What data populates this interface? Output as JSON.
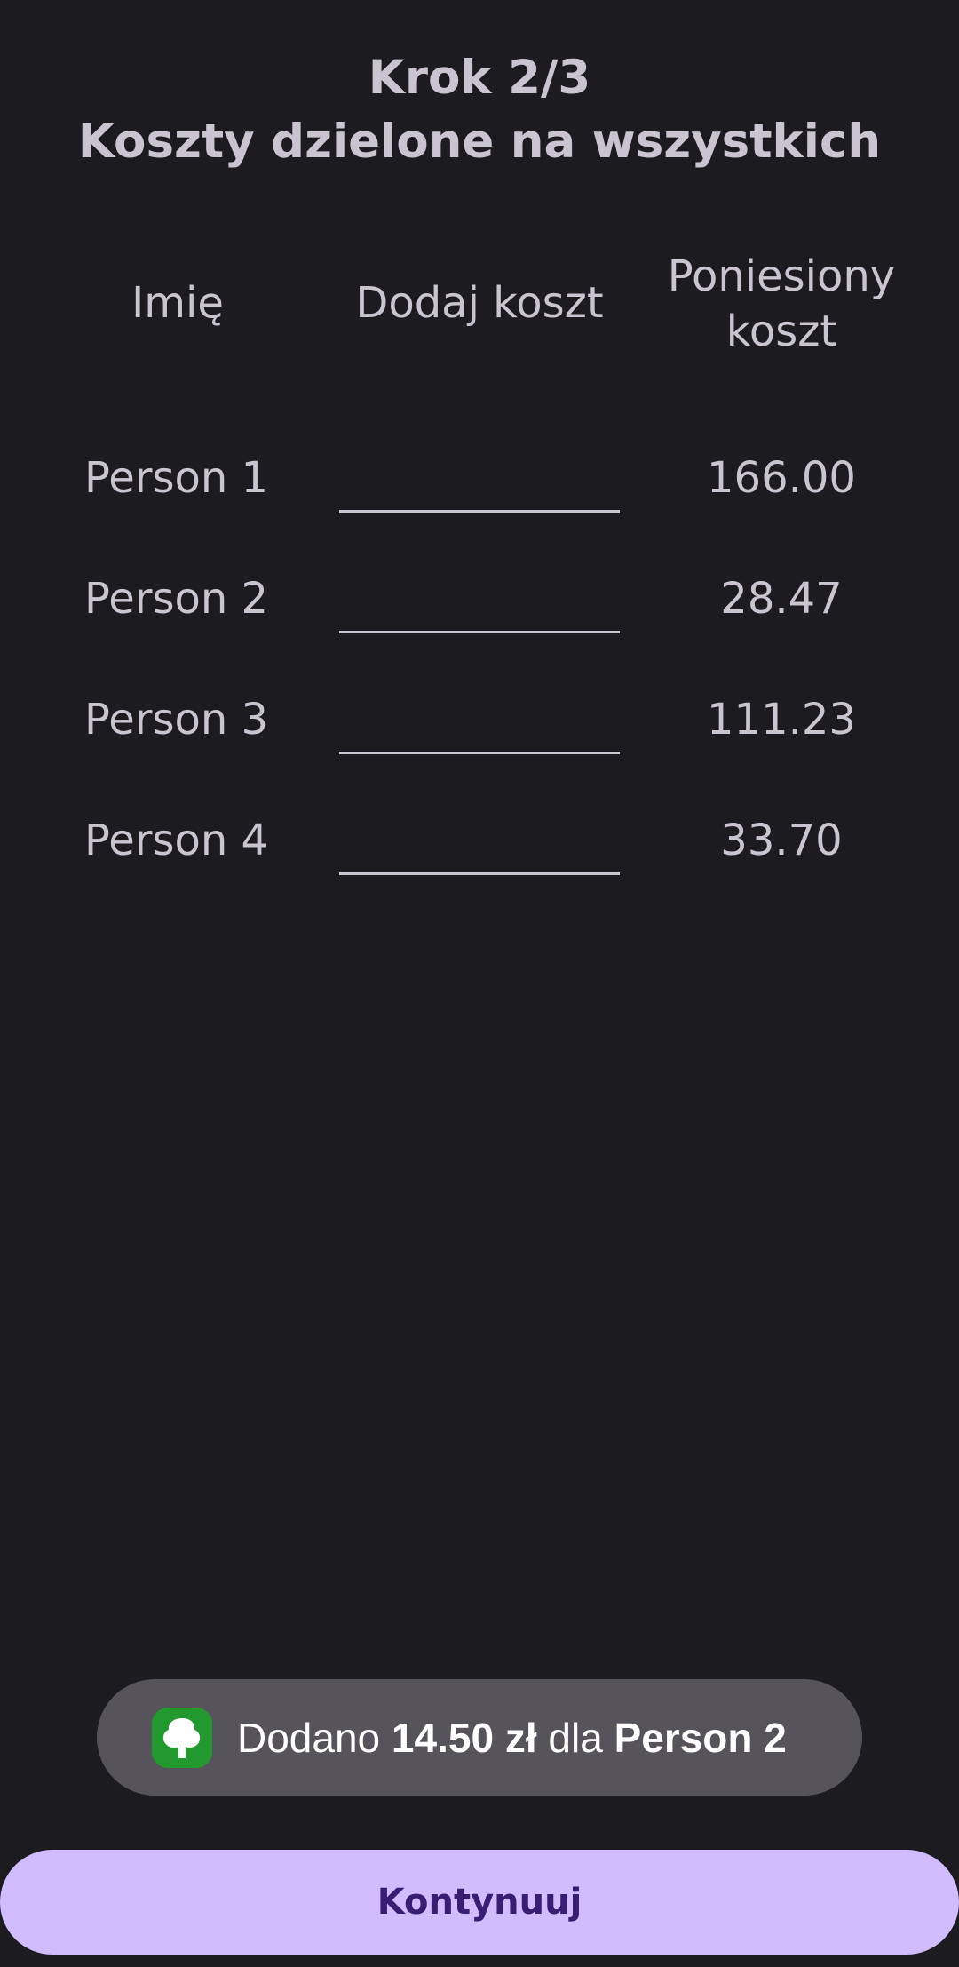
{
  "header": {
    "step": "Krok 2/3",
    "subtitle": "Koszty dzielone na wszystkich"
  },
  "table": {
    "columns": {
      "name": "Imię",
      "add_cost": "Dodaj koszt",
      "paid_line1": "Poniesiony",
      "paid_line2": "koszt"
    },
    "rows": [
      {
        "name": "Person 1",
        "input_value": "",
        "paid": "166.00"
      },
      {
        "name": "Person 2",
        "input_value": "",
        "paid": "28.47"
      },
      {
        "name": "Person 3",
        "input_value": "",
        "paid": "111.23"
      },
      {
        "name": "Person 4",
        "input_value": "",
        "paid": "33.70"
      }
    ]
  },
  "toast": {
    "icon": "app-tree-icon",
    "prefix": "Dodano ",
    "amount": "14.50 zł",
    "middle": " dla ",
    "person": "Person 2"
  },
  "continue_button": {
    "label": "Kontynuuj"
  },
  "colors": {
    "background": "#1c1b20",
    "text": "#cac4d0",
    "toast_bg": "#56545a",
    "button_bg": "#d0bcff",
    "button_text": "#381e72",
    "icon_green": "#22992e"
  }
}
